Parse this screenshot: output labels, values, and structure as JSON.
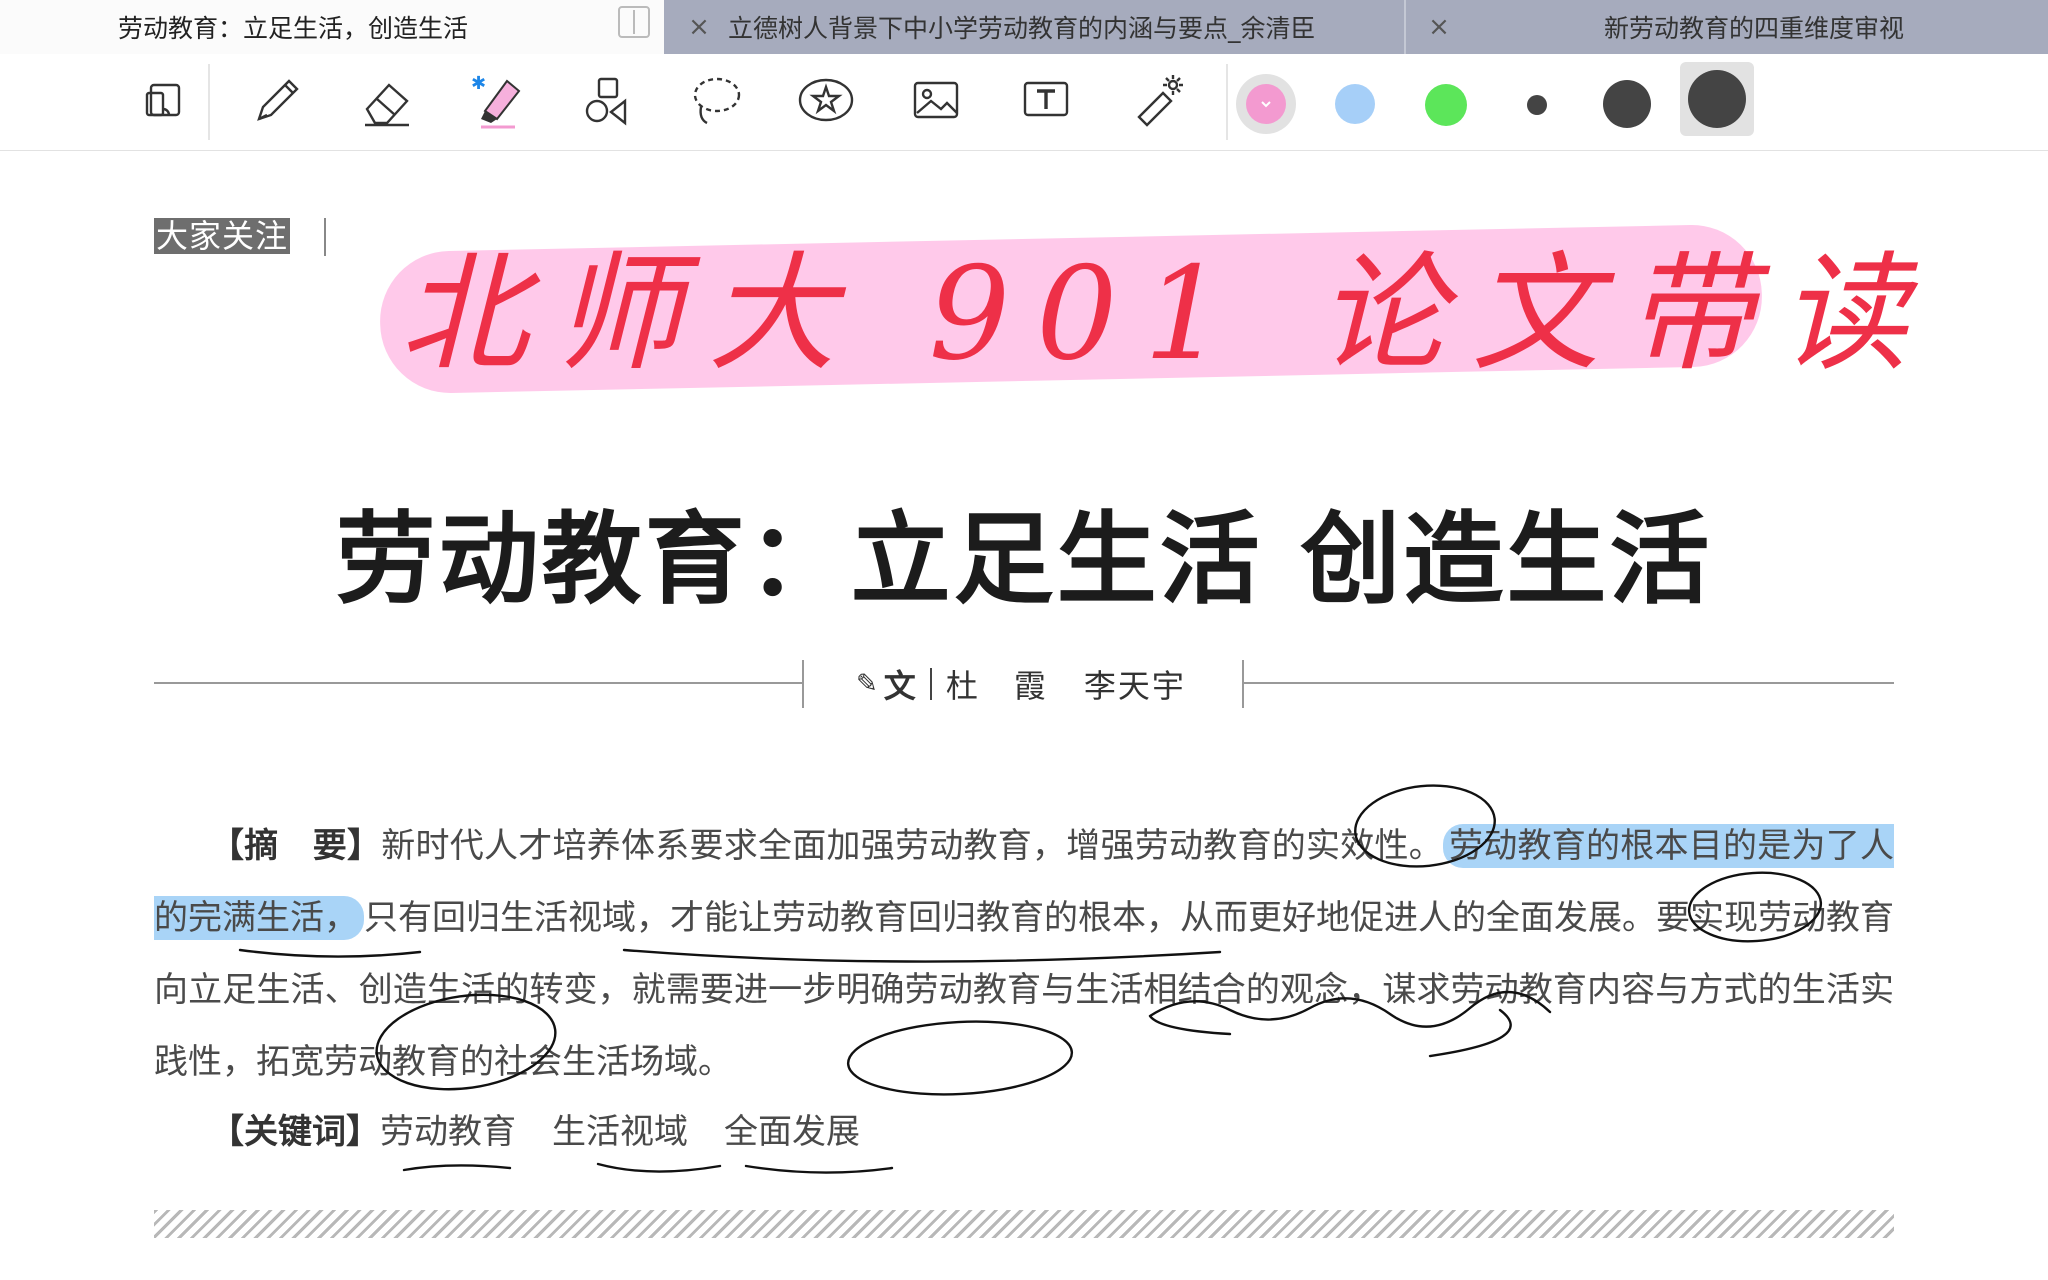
{
  "tabs": [
    {
      "label": "劳动教育：立足生活，创造生活",
      "active": true
    },
    {
      "label": "立德树人背景下中小学劳动教育的内涵与要点_余清臣",
      "active": false
    },
    {
      "label": "新劳动教育的四重维度审视",
      "active": false
    }
  ],
  "tab_close_glyph": "×",
  "toolbar": {
    "tools": [
      "page-layout-icon",
      "pencil-icon",
      "eraser-icon",
      "highlighter-icon",
      "shapes-icon",
      "lasso-icon",
      "sticker-icon",
      "image-icon",
      "text-box-icon",
      "laser-pointer-icon"
    ],
    "colors": [
      "#f39ad0",
      "#a6cff8",
      "#5ce65a"
    ],
    "selected_color": "#f39ad0",
    "sizes": [
      "small",
      "medium",
      "large"
    ],
    "selected_size": "large"
  },
  "document": {
    "column_tag": "大家关注",
    "handwritten_title": "北师大 901 论文带读",
    "title": "劳动教育：立足生活 创造生活",
    "byline": {
      "prefix": "文",
      "authors": [
        "杜　霞",
        "李天宇"
      ]
    },
    "abstract": {
      "label": "【摘　要】",
      "text_before_highlight": "新时代人才培养体系要求全面加强劳动教育，增强劳动教育的实效性。",
      "highlighted": "劳动教育的根本目的是为了人的完满生活，",
      "text_after_highlight": "只有回归生活视域，才能让劳动教育回归教育的根本，从而更好地促进人的全面发展。要实现劳动教育向立足生活、创造生活的转变，就需要进一步明确劳动教育与生活相结合的观念，谋求劳动教育内容与方式的生活实践性，拓宽劳动教育的社会生活场域。"
    },
    "keywords": {
      "label": "【关键词】",
      "items": [
        "劳动教育",
        "生活视域",
        "全面发展"
      ]
    }
  },
  "colors": {
    "highlighter_pink": "#ffc4e8",
    "ink_red": "#ee3048",
    "highlight_blue": "#a9d4f7",
    "ink_black": "#111111"
  }
}
